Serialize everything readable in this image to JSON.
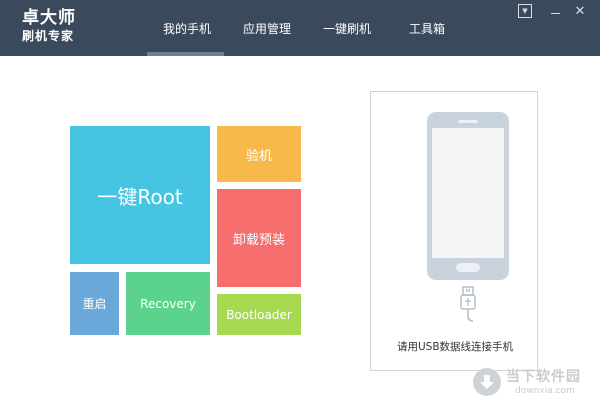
{
  "app": {
    "logo_line1": "卓大师",
    "logo_line2": "刷机专家"
  },
  "nav": {
    "active_index": 0,
    "tabs": [
      {
        "label": "我的手机"
      },
      {
        "label": "应用管理"
      },
      {
        "label": "一键刷机"
      },
      {
        "label": "工具箱"
      }
    ]
  },
  "window_controls": {
    "menu_glyph": "▼",
    "close_glyph": "✕"
  },
  "tiles": {
    "root": "一键Root",
    "check": "验机",
    "uninstall": "卸载预装",
    "reboot": "重启",
    "recovery": "Recovery",
    "bootloader": "Bootloader"
  },
  "panel": {
    "connect_text": "请用USB数据线连接手机"
  },
  "watermark": {
    "text_cn": "当下软件园",
    "text_url": "downxia.com"
  },
  "colors": {
    "header_bg": "#3a4a5c",
    "root": "#45c5e2",
    "check": "#f7b94a",
    "uninstall": "#f56d6d",
    "reboot": "#6aa8d9",
    "recovery": "#5cd38c",
    "bootloader": "#a6d94f"
  },
  "icons": {
    "phone": "smartphone-icon",
    "usb": "usb-cable-icon",
    "watermark": "download-icon"
  }
}
